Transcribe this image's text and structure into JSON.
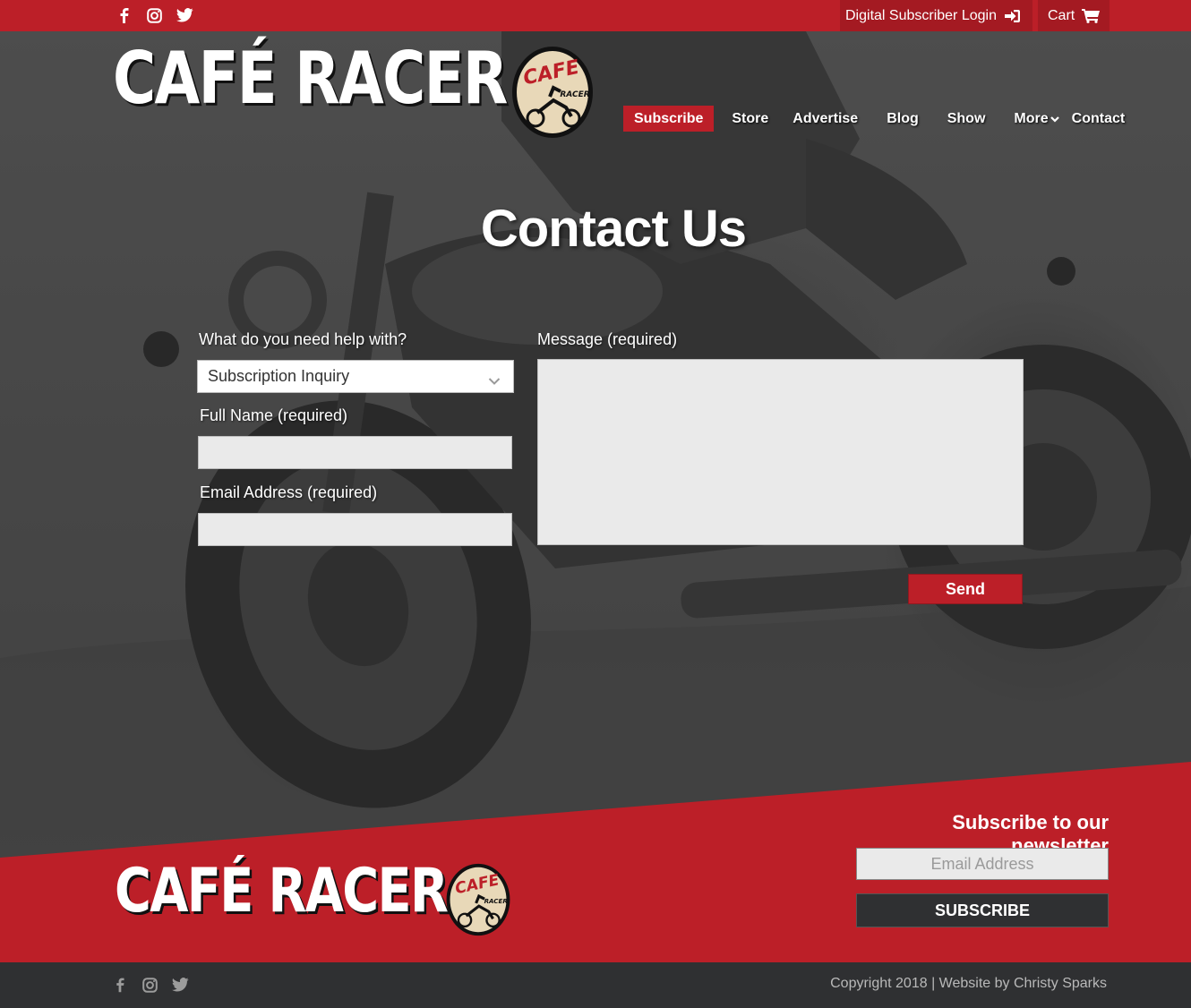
{
  "topbar": {
    "social": [
      "facebook-icon",
      "instagram-icon",
      "twitter-icon"
    ],
    "login_label": "Digital Subscriber Login",
    "cart_label": "Cart"
  },
  "brand": {
    "name": "CAFÉ RACER",
    "badge_top": "CAFE",
    "badge_bottom": "RACER"
  },
  "nav": {
    "items": [
      "Subscribe",
      "Store",
      "Advertise",
      "Blog",
      "Show",
      "More",
      "Contact"
    ]
  },
  "page": {
    "title": "Contact Us"
  },
  "form": {
    "help_label": "What do you need help with?",
    "help_value": "Subscription Inquiry",
    "name_label": "Full Name (required)",
    "email_label": "Email Address (required)",
    "message_label": "Message (required)",
    "send_label": "Send"
  },
  "newsletter": {
    "title": "Subscribe to our newsletter",
    "placeholder": "Email Address",
    "button": "SUBSCRIBE"
  },
  "footer": {
    "copyright": "Copyright 2018 | Website by Christy Sparks"
  },
  "colors": {
    "brand_red": "#bc1f28",
    "dark": "#2f3032",
    "field_bg": "#eaeaea"
  }
}
